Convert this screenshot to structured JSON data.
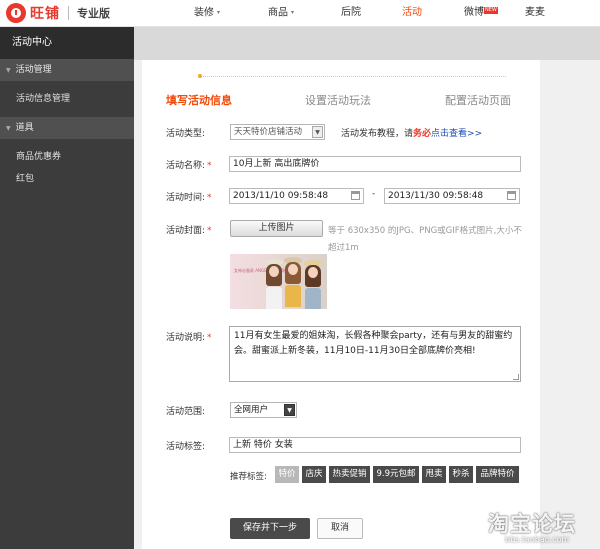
{
  "brand": {
    "logo_text": "旺铺",
    "edition": "专业版"
  },
  "nav": {
    "items": [
      {
        "label": "装修",
        "caret": "▾"
      },
      {
        "label": "商品",
        "caret": "▾"
      },
      {
        "label": "后院"
      },
      {
        "label": "活动",
        "active": true
      },
      {
        "label": "微博",
        "badge": "NEW"
      },
      {
        "label": "麦麦"
      }
    ]
  },
  "sidebar": {
    "title": "活动中心",
    "groups": [
      {
        "label": "活动管理",
        "items": [
          "活动信息管理"
        ]
      },
      {
        "label": "道具",
        "items": [
          "商品优惠券",
          "红包"
        ]
      }
    ],
    "collapse_icon": "◂"
  },
  "steps": [
    "填写活动信息",
    "设置活动玩法",
    "配置活动页面"
  ],
  "form": {
    "type": {
      "label": "活动类型:",
      "value": "天天特价店铺活动"
    },
    "tutorial": {
      "prefix": "活动发布教程，请",
      "emph": "务必",
      "link": "点击查看>>"
    },
    "name": {
      "label": "活动名称:",
      "value": "10月上新 高出底牌价"
    },
    "time": {
      "label": "活动时间:",
      "start": "2013/11/10 09:58:48",
      "sep": "-",
      "end": "2013/11/30 09:58:48"
    },
    "cover": {
      "label": "活动封面:",
      "upload_label": "上传图片",
      "hint": "等于 630x350 的JPG、PNG或GIF格式图片,大小不超过1m",
      "banner_text": "女神必备款 ANGEL ME 全场包邮"
    },
    "desc": {
      "label": "活动说明:",
      "value": "11月有女生最爱的姐妹淘，长假各种聚会party，还有与男友的甜蜜约会。甜蜜派上新冬装，11月10日-11月30日全部底牌价亮相!"
    },
    "scope": {
      "label": "活动范围:",
      "value": "全网用户"
    },
    "tags": {
      "label": "活动标签:",
      "value": "上新 特价 女装"
    },
    "recommended": {
      "label": "推荐标签:",
      "items": [
        "特价",
        "店庆",
        "热卖促销",
        "9.9元包邮",
        "甩卖",
        "秒杀",
        "品牌特价"
      ]
    },
    "required_mark": "*",
    "dropdown_arrow": "▼"
  },
  "actions": {
    "save": "保存并下一步",
    "cancel": "取消"
  },
  "watermark": {
    "title": "淘宝论坛",
    "url": "bbs.taobao.com"
  },
  "colors": {
    "accent": "#f34a0b",
    "sidebar_bg": "#3c3c3c",
    "tag_bg": "#4a4a4a"
  }
}
